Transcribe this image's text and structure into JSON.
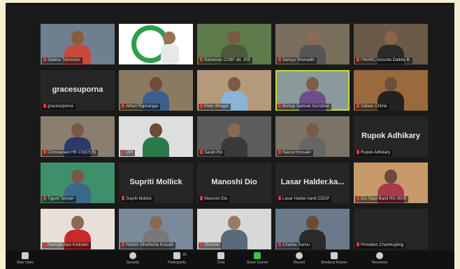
{
  "tiles": [
    {
      "name": "Sabina Tdemonis",
      "kind": "video",
      "skin": "#8b5a3c",
      "shirt": "#c84a3a",
      "bg": "#6f7f8f"
    },
    {
      "name": "",
      "kind": "logo",
      "skin": "#9b7155",
      "shirt": "#ddd",
      "bg": "#ffffff"
    },
    {
      "name": "Rahaman CDBF dd. 205",
      "kind": "video",
      "skin": "#7a5a45",
      "shirt": "#4a5a3a",
      "bg": "#5f7a4a"
    },
    {
      "name": "Samya Shonaidh",
      "kind": "video",
      "skin": "#8a6a55",
      "shirt": "#555",
      "bg": "#7a6e5e"
    },
    {
      "name": "FMARC lunsoda Dalkita B.",
      "kind": "video",
      "skin": "#8c6549",
      "shirt": "#2a2a2a",
      "bg": "#6b5a48"
    },
    {
      "name": "gracesuporna",
      "kind": "text",
      "big": "gracesuporna"
    },
    {
      "name": "Alfred Rajmangai",
      "kind": "video",
      "skin": "#6e4e3a",
      "shirt": "#3b5f8c",
      "bg": "#8a7a62"
    },
    {
      "name": "Peter Bhagat",
      "kind": "video",
      "skin": "#7c5a44",
      "shirt": "#8bb5d8",
      "bg": "#b49a7a"
    },
    {
      "name": "Bishop Samuel Sunshine",
      "kind": "video",
      "skin": "#7d5e4a",
      "shirt": "#6b4e8a",
      "bg": "#8a9a9a",
      "active": true
    },
    {
      "name": "Sabian Chlirla",
      "kind": "video",
      "skin": "#6f4f3b",
      "shirt": "#222",
      "bg": "#9a6a3a"
    },
    {
      "name": "Christianaid HR CS(C5 B)",
      "kind": "video",
      "skin": "#7a5844",
      "shirt": "#2b3a6a",
      "bg": "#8a7e6e"
    },
    {
      "name": "OPI",
      "kind": "video",
      "skin": "#6a4a38",
      "shirt": "#2b7a4a",
      "bg": "#dedede"
    },
    {
      "name": "Sarah Pol",
      "kind": "video",
      "skin": "#8a6a50",
      "shirt": "#3a3a3a",
      "bg": "#5c5c5c"
    },
    {
      "name": "Nasrul Hossain",
      "kind": "video",
      "skin": "#7a5a46",
      "shirt": "#666",
      "bg": "#7a7466"
    },
    {
      "name": "Rupok Adhikary",
      "kind": "text",
      "big": "Rupok Adhikary"
    },
    {
      "name": "Tigorit Tamser",
      "kind": "video",
      "skin": "#7a5644",
      "shirt": "#3a6a8a",
      "bg": "#3f8f6a"
    },
    {
      "name": "Supriti Mollick",
      "kind": "text",
      "big": "Supriti  Mollick"
    },
    {
      "name": "Manoshi Dio",
      "kind": "text",
      "big": "Manoshi Dio"
    },
    {
      "name": "Lasar Halder kanti CDDP",
      "kind": "text",
      "big": "Lasar  Halder.ka..."
    },
    {
      "name": "Dio Sipal Banti RO 3000",
      "kind": "video",
      "skin": "#6a4a38",
      "shirt": "#a83a4a",
      "bg": "#c89a6a"
    },
    {
      "name": "Navogle Apu Kodowin",
      "kind": "video",
      "skin": "#8a6a55",
      "shirt": "#c82a2a",
      "bg": "#e8e0d8"
    },
    {
      "name": "Nahbin Dharhoria Kruuah",
      "kind": "video",
      "skin": "#8a6a55",
      "shirt": "#777",
      "bg": "#7a8a9a"
    },
    {
      "name": "Sharmin",
      "kind": "video",
      "skin": "#9a7a65",
      "shirt": "#5a6a7a",
      "bg": "#d8d8d8"
    },
    {
      "name": "Charles Sanvu",
      "kind": "video",
      "skin": "#6a4a38",
      "shirt": "#2a2a2a",
      "bg": "#6a7a8a"
    },
    {
      "name": "Pinnakes Chamkupling",
      "kind": "blank"
    }
  ],
  "toolbar": [
    {
      "label": "Stop Video",
      "style": "gray"
    },
    {
      "label": "Security",
      "style": "round"
    },
    {
      "label": "Participants",
      "style": "gray",
      "count": "25"
    },
    {
      "label": "Chat",
      "style": "gray"
    },
    {
      "label": "Share Screen",
      "style": "green"
    },
    {
      "label": "Record",
      "style": "round"
    },
    {
      "label": "Breakout Rooms",
      "style": "gray"
    },
    {
      "label": "Reactions",
      "style": "round"
    }
  ]
}
